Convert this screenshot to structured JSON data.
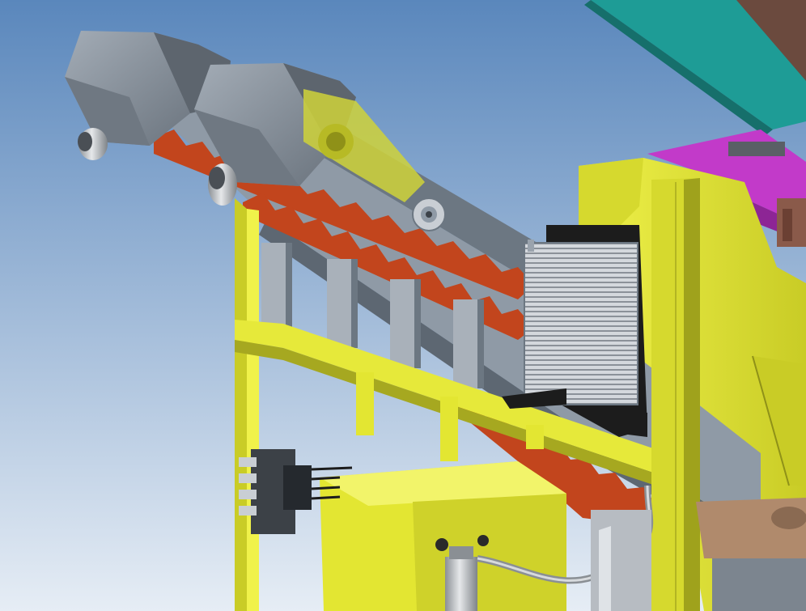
{
  "scene": {
    "colors": {
      "sky_top": "#5a87bc",
      "sky_bottom": "#dfe8f2",
      "frame_yellow": "#e3e632",
      "frame_yellow_shade": "#b8bb22",
      "frame_yellow_dark": "#8f9118",
      "steel_gray": "#8f9aa6",
      "steel_dark": "#5d6772",
      "hood_gray": "#7c858f",
      "hood_light": "#9aa3ad",
      "serration_red": "#c2451d",
      "teal": "#1e9c96",
      "magenta": "#c23ac9",
      "brown": "#8a5a4a",
      "radiator": "#c9ced4",
      "black": "#1c1c1c",
      "tan": "#b08a6c"
    },
    "icons": [
      "valve-bank-icon",
      "oil-cooler-icon",
      "hydraulic-filter-icon",
      "bearing-icon"
    ]
  }
}
